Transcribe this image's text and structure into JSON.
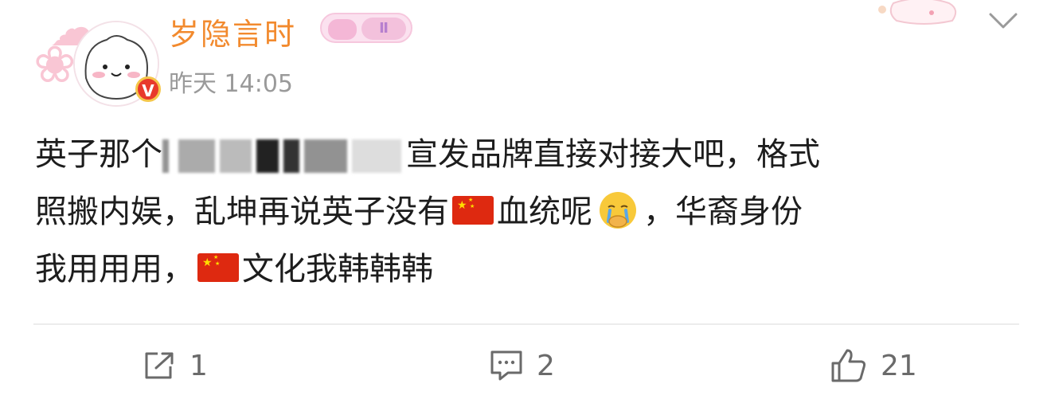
{
  "post": {
    "username": "岁隐言时",
    "badge_label": "Ⅱ",
    "timestamp": "昨天 14:05",
    "verified_mark": "V",
    "content": {
      "line1_prefix": "英子那个",
      "line1_suffix": "宣发品牌直接对接大吧，格式",
      "line2_a": "照搬内娱，乱坤再说英子没有",
      "line2_b": "血统呢",
      "line2_c": "，华裔身份",
      "line3_a": "我用用用，",
      "line3_b": "文化我韩韩韩"
    }
  },
  "actions": {
    "repost_count": "1",
    "comment_count": "2",
    "like_count": "21"
  },
  "icons": {
    "repost": "share-icon",
    "comment": "comment-icon",
    "like": "thumbs-up-icon",
    "dropdown": "chevron-down-icon",
    "flag": "china-flag-icon",
    "emoji": "crying-face-icon"
  },
  "colors": {
    "username": "#f28a2e",
    "timestamp": "#9a9a9a",
    "text": "#1d1d1d",
    "icons": "#6a6a6a",
    "verified": "#e8392b"
  }
}
